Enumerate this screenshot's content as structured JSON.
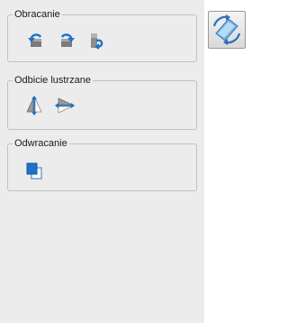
{
  "groups": {
    "rotate": {
      "title": "Obracanie",
      "buttons": [
        {
          "icon": "rotate-left-icon"
        },
        {
          "icon": "rotate-right-icon"
        },
        {
          "icon": "rotate-180-icon"
        }
      ]
    },
    "mirror": {
      "title": "Odbicie lustrzane",
      "buttons": [
        {
          "icon": "mirror-vertical-icon"
        },
        {
          "icon": "mirror-horizontal-icon"
        }
      ]
    },
    "flip": {
      "title": "Odwracanie",
      "buttons": [
        {
          "icon": "flip-layers-icon"
        }
      ]
    }
  },
  "preview": {
    "icon": "transform-preview-icon"
  },
  "colors": {
    "panel_bg": "#ececec",
    "icon_blue": "#1f72c9",
    "icon_gray": "#8d8d8d"
  }
}
